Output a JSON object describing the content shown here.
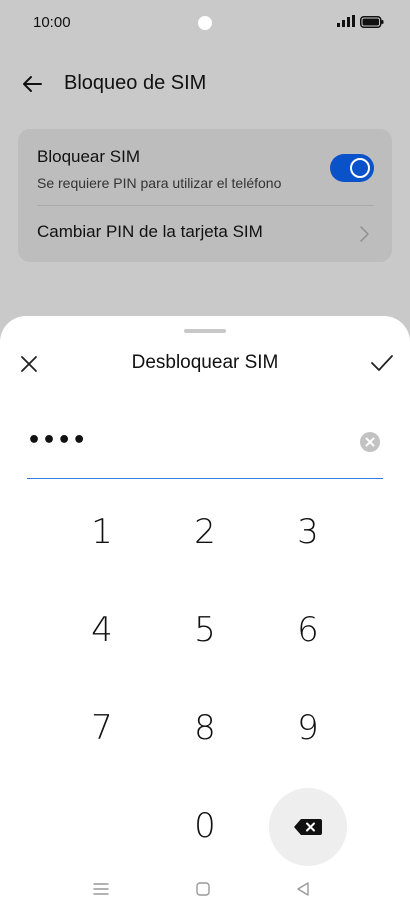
{
  "status_bar": {
    "time": "10:00"
  },
  "header": {
    "title": "Bloqueo de SIM"
  },
  "settings": {
    "lock_sim": {
      "title": "Bloquear SIM",
      "subtitle": "Se requiere PIN para utilizar el teléfono",
      "enabled": true
    },
    "change_pin": {
      "title": "Cambiar PIN de la tarjeta SIM"
    }
  },
  "sheet": {
    "title": "Desbloquear SIM",
    "pin_value": "••••"
  },
  "keypad": {
    "keys": [
      "1",
      "2",
      "3",
      "4",
      "5",
      "6",
      "7",
      "8",
      "9",
      "0"
    ]
  },
  "colors": {
    "accent": "#0a52c9",
    "field_underline": "#2f7de1"
  },
  "icons": [
    "back-arrow-icon",
    "close-icon",
    "check-icon",
    "clear-icon",
    "backspace-icon",
    "chevron-right-icon"
  ]
}
